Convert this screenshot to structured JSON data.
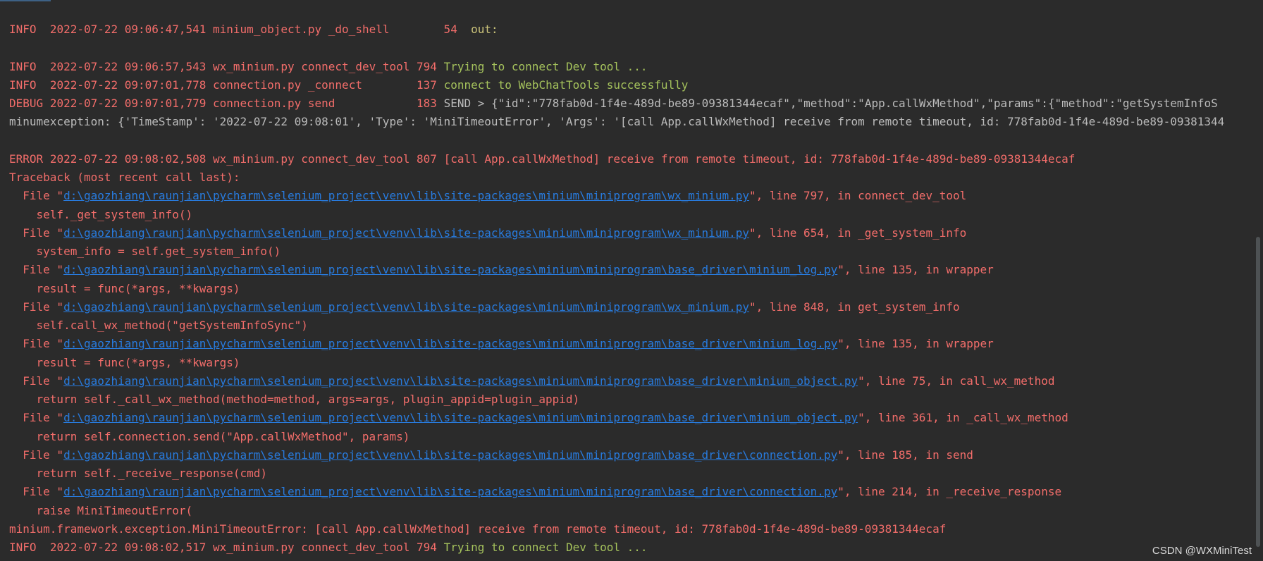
{
  "lines": [
    {
      "level": "INFO ",
      "timestamp": "2022-07-22 09:06:47,541",
      "module": "minium_object.py",
      "func": "_do_shell      ",
      "lineno": " 54 ",
      "message": "out:"
    },
    {},
    {
      "level": "INFO ",
      "timestamp": "2022-07-22 09:06:57,543",
      "module": "wx_minium.py",
      "func": "connect_dev_tool",
      "lineno": "794",
      "message": "Trying to connect Dev tool ..."
    },
    {
      "level": "INFO ",
      "timestamp": "2022-07-22 09:07:01,778",
      "module": "connection.py",
      "func": "_connect       ",
      "lineno": "137",
      "message": "connect to WebChatTools successfully"
    },
    {
      "level": "DEBUG",
      "timestamp": "2022-07-22 09:07:01,779",
      "module": "connection.py",
      "func": "send           ",
      "lineno": "183",
      "message": "SEND > {\"id\":\"778fab0d-1f4e-489d-be89-09381344ecaf\",\"method\":\"App.callWxMethod\",\"params\":{\"method\":\"getSystemInfoS"
    },
    {
      "text": "minumexception: {'TimeStamp': '2022-07-22 09:08:01', 'Type': 'MiniTimeoutError', 'Args': '[call App.callWxMethod] receive from remote timeout, id: 778fab0d-1f4e-489d-be89-09381344"
    },
    {},
    {
      "level": "ERROR",
      "timestamp": "2022-07-22 09:08:02,508",
      "module": "wx_minium.py",
      "func": "connect_dev_tool",
      "lineno": "807",
      "message": "[call App.callWxMethod] receive from remote timeout, id: 778fab0d-1f4e-489d-be89-09381344ecaf"
    },
    {
      "text": "Traceback (most recent call last):"
    },
    {
      "prefix": "  File \"",
      "path": "d:\\gaozhiang\\raunjian\\pycharm\\selenium_project\\venv\\lib\\site-packages\\minium\\miniprogram\\wx_minium.py",
      "suffix": "\", line 797, in connect_dev_tool"
    },
    {
      "text": "    self._get_system_info()"
    },
    {
      "prefix": "  File \"",
      "path": "d:\\gaozhiang\\raunjian\\pycharm\\selenium_project\\venv\\lib\\site-packages\\minium\\miniprogram\\wx_minium.py",
      "suffix": "\", line 654, in _get_system_info"
    },
    {
      "text": "    system_info = self.get_system_info()"
    },
    {
      "prefix": "  File \"",
      "path": "d:\\gaozhiang\\raunjian\\pycharm\\selenium_project\\venv\\lib\\site-packages\\minium\\miniprogram\\base_driver\\minium_log.py",
      "suffix": "\", line 135, in wrapper"
    },
    {
      "text": "    result = func(*args, **kwargs)"
    },
    {
      "prefix": "  File \"",
      "path": "d:\\gaozhiang\\raunjian\\pycharm\\selenium_project\\venv\\lib\\site-packages\\minium\\miniprogram\\wx_minium.py",
      "suffix": "\", line 848, in get_system_info"
    },
    {
      "text": "    self.call_wx_method(\"getSystemInfoSync\")"
    },
    {
      "prefix": "  File \"",
      "path": "d:\\gaozhiang\\raunjian\\pycharm\\selenium_project\\venv\\lib\\site-packages\\minium\\miniprogram\\base_driver\\minium_log.py",
      "suffix": "\", line 135, in wrapper"
    },
    {
      "text": "    result = func(*args, **kwargs)"
    },
    {
      "prefix": "  File \"",
      "path": "d:\\gaozhiang\\raunjian\\pycharm\\selenium_project\\venv\\lib\\site-packages\\minium\\miniprogram\\base_driver\\minium_object.py",
      "suffix": "\", line 75, in call_wx_method"
    },
    {
      "text": "    return self._call_wx_method(method=method, args=args, plugin_appid=plugin_appid)"
    },
    {
      "prefix": "  File \"",
      "path": "d:\\gaozhiang\\raunjian\\pycharm\\selenium_project\\venv\\lib\\site-packages\\minium\\miniprogram\\base_driver\\minium_object.py",
      "suffix": "\", line 361, in _call_wx_method"
    },
    {
      "text": "    return self.connection.send(\"App.callWxMethod\", params)"
    },
    {
      "prefix": "  File \"",
      "path": "d:\\gaozhiang\\raunjian\\pycharm\\selenium_project\\venv\\lib\\site-packages\\minium\\miniprogram\\base_driver\\connection.py",
      "suffix": "\", line 185, in send"
    },
    {
      "text": "    return self._receive_response(cmd)"
    },
    {
      "prefix": "  File \"",
      "path": "d:\\gaozhiang\\raunjian\\pycharm\\selenium_project\\venv\\lib\\site-packages\\minium\\miniprogram\\base_driver\\connection.py",
      "suffix": "\", line 214, in _receive_response"
    },
    {
      "text": "    raise MiniTimeoutError("
    },
    {
      "text": "minium.framework.exception.MiniTimeoutError: [call App.callWxMethod] receive from remote timeout, id: 778fab0d-1f4e-489d-be89-09381344ecaf"
    },
    {
      "level": "INFO ",
      "timestamp": "2022-07-22 09:08:02,517",
      "module": "wx_minium.py",
      "func": "connect_dev_tool",
      "lineno": "794",
      "message": "Trying to connect Dev tool ..."
    }
  ],
  "watermark": "CSDN @WXMiniTest",
  "colors": {
    "background": "#2b2b2b",
    "error_text": "#f26d6a",
    "plain_text": "#bbbbbb",
    "info_message": "#a5c25c",
    "shell_message": "#cbc37a",
    "link": "#287bde"
  }
}
